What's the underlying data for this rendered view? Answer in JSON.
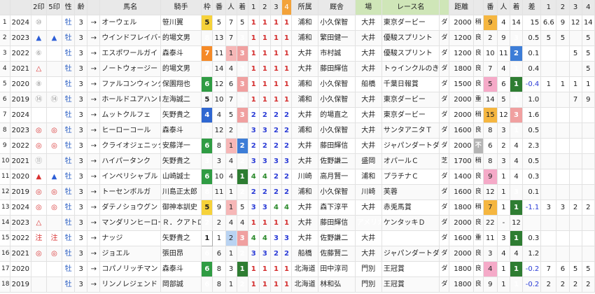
{
  "columns": [
    "",
    "",
    "2印",
    "5印",
    "性",
    "齢",
    "",
    "馬名",
    "騎手",
    "枠",
    "番",
    "人",
    "着",
    "1",
    "2",
    "3",
    "4",
    "所属",
    "厩舎",
    "場",
    "レース名",
    "",
    "距離",
    "",
    "番",
    "人",
    "着",
    "差",
    "1",
    "2",
    "3",
    "4"
  ],
  "icons": {
    "arrow": "right-arrow-icon"
  },
  "rows": [
    {
      "no": "1",
      "year": "2024",
      "m2": "⑩",
      "m2c": "gray",
      "m5": "",
      "m5c": "",
      "sex": "牡",
      "age": "3",
      "arrow": "→",
      "name": "オーウェル",
      "jockey": "笹川翼",
      "gate": "5",
      "num": "5",
      "pop": "7",
      "fin": "5",
      "c1": "1",
      "c2": "1",
      "c3": "1",
      "c4": "1",
      "aff": "浦和",
      "stable": "小久保智",
      "venue": "大井",
      "race": "東京ダービー",
      "surface": "ダ",
      "dist": "2000",
      "cond": "稍",
      "rnum": "9",
      "rpop": "4",
      "rfin": "14",
      "diff": "15",
      "r1": "6.6",
      "r2": "9",
      "r3": "12",
      "r4": "14"
    },
    {
      "no": "2",
      "year": "2023",
      "m2": "▲",
      "m2c": "blue",
      "m5": "▲",
      "m5c": "blue",
      "sex": "牡",
      "age": "3",
      "arrow": "→",
      "name": "ウインドフレイバー",
      "jockey": "的場文男",
      "gate": "8",
      "num": "13",
      "pop": "7",
      "fin": "3",
      "c1": "1",
      "c2": "1",
      "c3": "1",
      "c4": "1",
      "aff": "浦和",
      "stable": "繁田健一",
      "venue": "大井",
      "race": "優駿スプリント",
      "surface": "ダ",
      "dist": "1200",
      "cond": "良",
      "rnum": "2",
      "rpop": "9",
      "rfin": "3",
      "diff": "0.5",
      "r1": "5",
      "r2": "5",
      "r3": "",
      "r4": "5"
    },
    {
      "no": "3",
      "year": "2022",
      "m2": "⑥",
      "m2c": "gray",
      "m5": "",
      "m5c": "",
      "sex": "牡",
      "age": "3",
      "arrow": "→",
      "name": "エスポワールガイ",
      "jockey": "森泰斗",
      "gate": "7",
      "num": "11",
      "pop": "1",
      "fin": "3",
      "c1": "1",
      "c2": "1",
      "c3": "1",
      "c4": "1",
      "aff": "大井",
      "stable": "市村誠",
      "venue": "大井",
      "race": "優駿スプリント",
      "surface": "ダ",
      "dist": "1200",
      "cond": "良",
      "rnum": "10",
      "rpop": "11",
      "rfin": "2",
      "diff": "0.1",
      "r1": "",
      "r2": "",
      "r3": "5",
      "r4": "5"
    },
    {
      "no": "4",
      "year": "2021",
      "m2": "△",
      "m2c": "red",
      "m5": "",
      "m5c": "",
      "sex": "牡",
      "age": "3",
      "arrow": "→",
      "name": "ノートウォージー",
      "jockey": "的場文男",
      "gate": "8",
      "num": "14",
      "pop": "4",
      "fin": "3",
      "c1": "1",
      "c2": "1",
      "c3": "1",
      "c4": "1",
      "aff": "大井",
      "stable": "藤田輝信",
      "venue": "大井",
      "race": "トゥインクルのきせき",
      "surface": "ダ",
      "dist": "1800",
      "cond": "良",
      "rnum": "7",
      "rpop": "4",
      "rfin": "1",
      "diff": "0.4",
      "r1": "",
      "r2": "",
      "r3": "",
      "r4": "5"
    },
    {
      "no": "5",
      "year": "2020",
      "m2": "⑧",
      "m2c": "gray",
      "m5": "",
      "m5c": "",
      "sex": "牡",
      "age": "3",
      "arrow": "→",
      "name": "ファルコンウィング",
      "jockey": "保園翔也",
      "gate": "6",
      "num": "12",
      "pop": "6",
      "fin": "3",
      "c1": "1",
      "c2": "1",
      "c3": "1",
      "c4": "1",
      "aff": "浦和",
      "stable": "小久保智",
      "venue": "船橋",
      "race": "千葉日報賞",
      "surface": "ダ",
      "dist": "1500",
      "cond": "良",
      "rnum": "5",
      "rpop": "6",
      "rfin": "1",
      "diff": "-0.4",
      "r1": "1",
      "r2": "1",
      "r3": "1",
      "r4": "1"
    },
    {
      "no": "6",
      "year": "2019",
      "m2": "⑭",
      "m2c": "gray",
      "m5": "⑭",
      "m5c": "gray",
      "sex": "牡",
      "age": "3",
      "arrow": "→",
      "name": "ホールドユアハンド",
      "jockey": "左海誠二",
      "gate": "5",
      "num": "10",
      "pop": "7",
      "fin": "3",
      "c1": "1",
      "c2": "1",
      "c3": "1",
      "c4": "1",
      "aff": "浦和",
      "stable": "小久保智",
      "venue": "大井",
      "race": "東京ダービー",
      "surface": "ダ",
      "dist": "2000",
      "cond": "重",
      "rnum": "14",
      "rpop": "5",
      "rfin": "1",
      "diff": "1.0",
      "r1": "",
      "r2": "",
      "r3": "7",
      "r4": "9"
    },
    {
      "no": "7",
      "year": "2024",
      "m2": "",
      "m2c": "",
      "m5": "",
      "m5c": "",
      "sex": "牡",
      "age": "3",
      "arrow": "→",
      "name": "ムットクルフェ",
      "jockey": "矢野貴之",
      "gate": "4",
      "num": "4",
      "pop": "5",
      "fin": "3",
      "c1": "2",
      "c2": "2",
      "c3": "2",
      "c4": "2",
      "aff": "大井",
      "stable": "的場直之",
      "venue": "大井",
      "race": "東京ダービー",
      "surface": "ダ",
      "dist": "2000",
      "cond": "稍",
      "rnum": "15",
      "rpop": "12",
      "rfin": "3",
      "diff": "1.6",
      "r1": "",
      "r2": "",
      "r3": "",
      "r4": ""
    },
    {
      "no": "8",
      "year": "2023",
      "m2": "◎",
      "m2c": "red",
      "m5": "◎",
      "m5c": "red",
      "sex": "牡",
      "age": "3",
      "arrow": "→",
      "name": "ヒーローコール",
      "jockey": "森泰斗",
      "gate": "7",
      "num": "12",
      "pop": "2",
      "fin": "1",
      "c1": "3",
      "c2": "3",
      "c3": "2",
      "c4": "2",
      "aff": "浦和",
      "stable": "小久保智",
      "venue": "大井",
      "race": "サンタアニタＴ",
      "surface": "ダ",
      "dist": "1600",
      "cond": "良",
      "rnum": "8",
      "rpop": "3",
      "rfin": "1",
      "diff": "0.5",
      "r1": "",
      "r2": "",
      "r3": "",
      "r4": ""
    },
    {
      "no": "9",
      "year": "2022",
      "m2": "◎",
      "m2c": "red",
      "m5": "◎",
      "m5c": "red",
      "sex": "牡",
      "age": "3",
      "arrow": "→",
      "name": "クライオジェニック",
      "jockey": "安藤洋一",
      "gate": "6",
      "num": "8",
      "pop": "1",
      "fin": "2",
      "c1": "2",
      "c2": "2",
      "c3": "2",
      "c4": "2",
      "aff": "大井",
      "stable": "藤田輝信",
      "venue": "大井",
      "race": "ジャパンダートダー",
      "surface": "ダ",
      "dist": "2000",
      "cond": "不",
      "rnum": "6",
      "rpop": "2",
      "rfin": "4",
      "diff": "2.3",
      "r1": "",
      "r2": "",
      "r3": "",
      "r4": ""
    },
    {
      "no": "10",
      "year": "2021",
      "m2": "⑪",
      "m2c": "gray",
      "m5": "",
      "m5c": "",
      "sex": "牡",
      "age": "3",
      "arrow": "→",
      "name": "ハイパータンク",
      "jockey": "矢野貴之",
      "gate": "3",
      "num": "3",
      "pop": "4",
      "fin": "2",
      "c1": "3",
      "c2": "3",
      "c3": "3",
      "c4": "3",
      "aff": "大井",
      "stable": "佐野謙二",
      "venue": "盛岡",
      "race": "オパールＣ",
      "surface": "芝",
      "dist": "1700",
      "cond": "稍",
      "rnum": "8",
      "rpop": "3",
      "rfin": "4",
      "diff": "0.5",
      "r1": "",
      "r2": "",
      "r3": "",
      "r4": ""
    },
    {
      "no": "11",
      "year": "2020",
      "m2": "▲",
      "m2c": "red",
      "m5": "▲",
      "m5c": "blue",
      "sex": "牡",
      "age": "3",
      "arrow": "→",
      "name": "インペリシャブル",
      "jockey": "山崎誠士",
      "gate": "6",
      "num": "10",
      "pop": "4",
      "fin": "1",
      "c1": "4",
      "c2": "4",
      "c3": "2",
      "c4": "2",
      "aff": "川崎",
      "stable": "高月賢一",
      "venue": "浦和",
      "race": "プラチナＣ",
      "surface": "ダ",
      "dist": "1400",
      "cond": "良",
      "rnum": "9",
      "rpop": "1",
      "rfin": "4",
      "diff": "0.3",
      "r1": "",
      "r2": "",
      "r3": "",
      "r4": ""
    },
    {
      "no": "12",
      "year": "2019",
      "m2": "◎",
      "m2c": "red",
      "m5": "◎",
      "m5c": "red",
      "sex": "牡",
      "age": "3",
      "arrow": "→",
      "name": "トーセンボルガ",
      "jockey": "川島正太郎",
      "gate": "8",
      "num": "11",
      "pop": "1",
      "fin": "2",
      "c1": "2",
      "c2": "2",
      "c3": "2",
      "c4": "2",
      "aff": "浦和",
      "stable": "小久保智",
      "venue": "川崎",
      "race": "芙蓉",
      "surface": "ダ",
      "dist": "1600",
      "cond": "良",
      "rnum": "12",
      "rpop": "1",
      "rfin": "3",
      "diff": "0.1",
      "r1": "",
      "r2": "",
      "r3": "",
      "r4": ""
    },
    {
      "no": "13",
      "year": "2024",
      "m2": "◎",
      "m2c": "red",
      "m5": "◎",
      "m5c": "red",
      "sex": "牡",
      "age": "3",
      "arrow": "→",
      "name": "ダテノショウグン",
      "jockey": "御神本訓史",
      "gate": "5",
      "num": "9",
      "pop": "1",
      "fin": "5",
      "c1": "3",
      "c2": "3",
      "c3": "4",
      "c4": "4",
      "aff": "大井",
      "stable": "森下淳平",
      "venue": "大井",
      "race": "赤兎馬賞",
      "surface": "ダ",
      "dist": "1800",
      "cond": "稍",
      "rnum": "7",
      "rpop": "1",
      "rfin": "1",
      "diff": "-1.1",
      "r1": "3",
      "r2": "3",
      "r3": "2",
      "r4": "2"
    },
    {
      "no": "14",
      "year": "2023",
      "m2": "△",
      "m2c": "red",
      "m5": "",
      "m5c": "",
      "sex": "牡",
      "age": "3",
      "arrow": "→",
      "name": "マンダリンヒーロー",
      "jockey": "Ｒ．クアトロ",
      "gate": "2",
      "num": "2",
      "pop": "4",
      "fin": "4",
      "c1": "1",
      "c2": "1",
      "c3": "1",
      "c4": "1",
      "aff": "大井",
      "stable": "藤田輝信",
      "venue": "アメリカ",
      "race": "ケンタッキＤ",
      "surface": "ダ",
      "dist": "2000",
      "cond": "良",
      "rnum": "22",
      "rpop": "-",
      "rfin": "12",
      "diff": "",
      "r1": "",
      "r2": "",
      "r3": "",
      "r4": ""
    },
    {
      "no": "15",
      "year": "2022",
      "m2": "注",
      "m2c": "red",
      "m5": "注",
      "m5c": "red",
      "sex": "牡",
      "age": "3",
      "arrow": "→",
      "name": "ナッジ",
      "jockey": "矢野貴之",
      "gate": "1",
      "num": "1",
      "pop": "2",
      "fin": "3",
      "c1": "4",
      "c2": "4",
      "c3": "3",
      "c4": "3",
      "aff": "大井",
      "stable": "佐野謙二",
      "venue": "大井",
      "race": "",
      "surface": "ダ",
      "dist": "1600",
      "cond": "重",
      "rnum": "11",
      "rpop": "3",
      "rfin": "1",
      "diff": "0.3",
      "r1": "",
      "r2": "",
      "r3": "",
      "r4": ""
    },
    {
      "no": "16",
      "year": "2021",
      "m2": "◎",
      "m2c": "red",
      "m5": "◎",
      "m5c": "red",
      "sex": "牡",
      "age": "3",
      "arrow": "→",
      "name": "ジョエル",
      "jockey": "張田昂",
      "gate": "6",
      "num": "6",
      "pop": "1",
      "fin": "2",
      "c1": "3",
      "c2": "3",
      "c3": "2",
      "c4": "2",
      "aff": "船橋",
      "stable": "佐藤賢二",
      "venue": "大井",
      "race": "ジャパンダートダー",
      "surface": "ダ",
      "dist": "2000",
      "cond": "良",
      "rnum": "3",
      "rpop": "4",
      "rfin": "4",
      "diff": "1.2",
      "r1": "",
      "r2": "",
      "r3": "",
      "r4": ""
    },
    {
      "no": "17",
      "year": "2020",
      "m2": "",
      "m2c": "",
      "m5": "",
      "m5c": "",
      "sex": "牡",
      "age": "3",
      "arrow": "→",
      "name": "コパノリッチマン",
      "jockey": "森泰斗",
      "gate": "6",
      "num": "8",
      "pop": "3",
      "fin": "1",
      "c1": "1",
      "c2": "1",
      "c3": "1",
      "c4": "1",
      "aff": "北海道",
      "stable": "田中淳司",
      "venue": "門別",
      "race": "王冠賞",
      "surface": "ダ",
      "dist": "1800",
      "cond": "良",
      "rnum": "4",
      "rpop": "1",
      "rfin": "1",
      "diff": "-0.2",
      "r1": "7",
      "r2": "6",
      "r3": "5",
      "r4": "5"
    },
    {
      "no": "18",
      "year": "2019",
      "m2": "",
      "m2c": "",
      "m5": "",
      "m5c": "",
      "sex": "牡",
      "age": "3",
      "arrow": "→",
      "name": "リンノレジェンド",
      "jockey": "岡部誠",
      "gate": "6",
      "num": "8",
      "pop": "1",
      "fin": "2",
      "c1": "1",
      "c2": "1",
      "c3": "1",
      "c4": "1",
      "aff": "北海道",
      "stable": "林和弘",
      "venue": "門別",
      "race": "王冠賞",
      "surface": "ダ",
      "dist": "1800",
      "cond": "良",
      "rnum": "9",
      "rpop": "1",
      "rfin": "1",
      "diff": "-0.2",
      "r1": "2",
      "r2": "2",
      "r3": "2",
      "r4": "2"
    }
  ]
}
